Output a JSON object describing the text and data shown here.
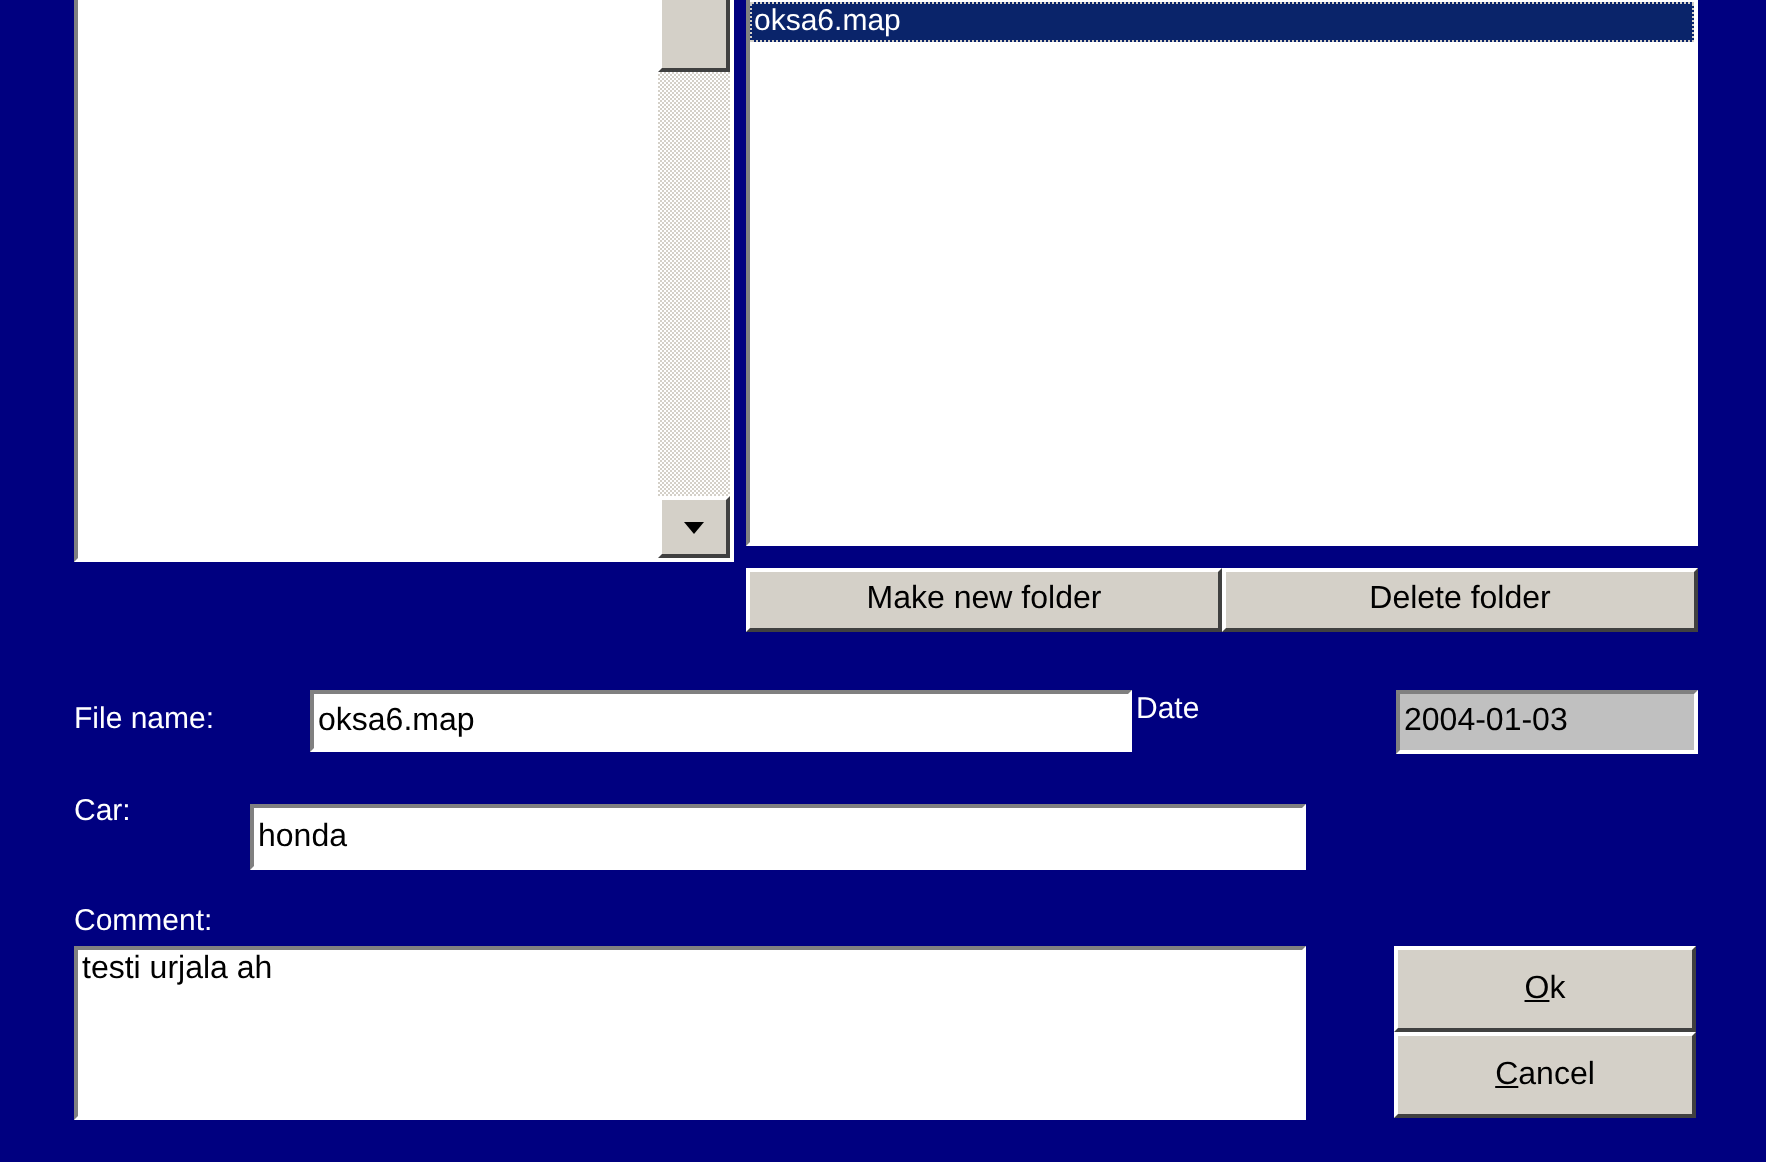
{
  "file_list": {
    "items": [
      {
        "name": "oksa6.map",
        "selected": true
      }
    ]
  },
  "folder_buttons": [
    {
      "label": "Make new folder"
    },
    {
      "label": "Delete folder"
    }
  ],
  "file_name": {
    "label": "File name:",
    "value": "oksa6.map"
  },
  "date": {
    "label": "Date",
    "value": "2004-01-03",
    "disabled": true
  },
  "car": {
    "label": "Car:",
    "value": "honda"
  },
  "comment": {
    "label": "Comment:",
    "value": "testi urjala ah"
  },
  "dialog_buttons": [
    {
      "accel": "O",
      "rest": "k"
    },
    {
      "accel": "C",
      "rest": "ancel"
    }
  ]
}
